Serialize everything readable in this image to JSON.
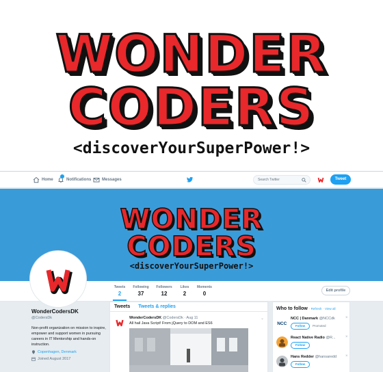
{
  "brand": {
    "line1": "WONDER",
    "line2": "CODERS",
    "tagline": "<discoverYourSuperPower!>"
  },
  "nav": {
    "home": "Home",
    "notifications": "Notifications",
    "messages": "Messages",
    "search_placeholder": "Search Twitter",
    "tweet_button": "Tweet"
  },
  "banner": {
    "line1": "WONDER",
    "line2": "CODERS",
    "tagline": "<discoverYourSuperPower!>"
  },
  "stats": [
    {
      "label": "Tweets",
      "value": "2"
    },
    {
      "label": "Following",
      "value": "37"
    },
    {
      "label": "Followers",
      "value": "12"
    },
    {
      "label": "Likes",
      "value": "2"
    },
    {
      "label": "Moments",
      "value": "0"
    }
  ],
  "edit_profile": "Edit profile",
  "profile": {
    "name": "WonderCodersDK",
    "handle": "@CodersDk",
    "bio": "Non-profit organization on mission to inspire, empower and support women in pursuing careers in IT Mentorship and hands-on instruction.",
    "location": "Copenhagen, Denmark",
    "joined": "Joined August 2017"
  },
  "feed": {
    "tab_tweets": "Tweets",
    "tab_replies": "Tweets & replies",
    "tweet": {
      "name": "WonderCodersDK",
      "meta": "@CodersDk · Aug 11",
      "text": "All hail Java Script! From jQuery to DOM and ES6"
    }
  },
  "who_to_follow": {
    "title": "Who to follow",
    "refresh": "· Refresh",
    "view_all": "· View all",
    "items": [
      {
        "name": "NCC | Danmark",
        "handle": "@NCCdk",
        "button": "Follow",
        "promoted": "Promoted"
      },
      {
        "name": "React Native Radio",
        "handle": "@R...",
        "button": "Follow",
        "promoted": ""
      },
      {
        "name": "Hans Redder",
        "handle": "@hansaredd",
        "button": "Follow",
        "promoted": ""
      }
    ]
  },
  "colors": {
    "brand_red": "#e8282b",
    "twitter_blue": "#1da1f2",
    "banner_blue": "#3a9bd9"
  }
}
